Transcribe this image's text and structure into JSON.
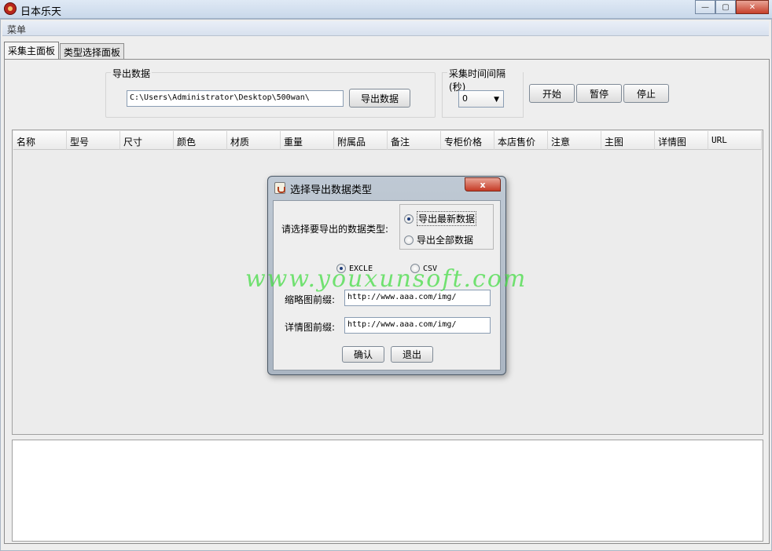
{
  "window": {
    "title": "日本乐天",
    "min": "—",
    "max": "▢",
    "close": "✕"
  },
  "menu": {
    "label": "菜单"
  },
  "tabs": [
    {
      "label": "采集主面板"
    },
    {
      "label": "类型选择面板"
    }
  ],
  "export_group": {
    "title": "导出数据",
    "path_value": "C:\\Users\\Administrator\\Desktop\\500wan\\",
    "export_button": "导出数据"
  },
  "interval_group": {
    "title": "采集时间间隔(秒)",
    "value": "0"
  },
  "controls": {
    "start": "开始",
    "pause": "暂停",
    "stop": "停止"
  },
  "table": {
    "columns": [
      "名称",
      "型号",
      "尺寸",
      "颜色",
      "材质",
      "重量",
      "附属品",
      "备注",
      "专柜价格",
      "本店售价",
      "注意",
      "主图",
      "详情图",
      "URL"
    ]
  },
  "dialog": {
    "title": "选择导出数据类型",
    "close": "x",
    "prompt": "请选择要导出的数据类型:",
    "option_latest": "导出最新数据",
    "option_all": "导出全部数据",
    "format_excle": "EXCLE",
    "format_csv": "CSV",
    "thumb_label": "缩略图前缀:",
    "thumb_value": "http://www.aaa.com/img/",
    "detail_label": "详情图前缀:",
    "detail_value": "http://www.aaa.com/img/",
    "confirm": "确认",
    "exit": "退出"
  },
  "watermark": "www.youxunsoft.com"
}
